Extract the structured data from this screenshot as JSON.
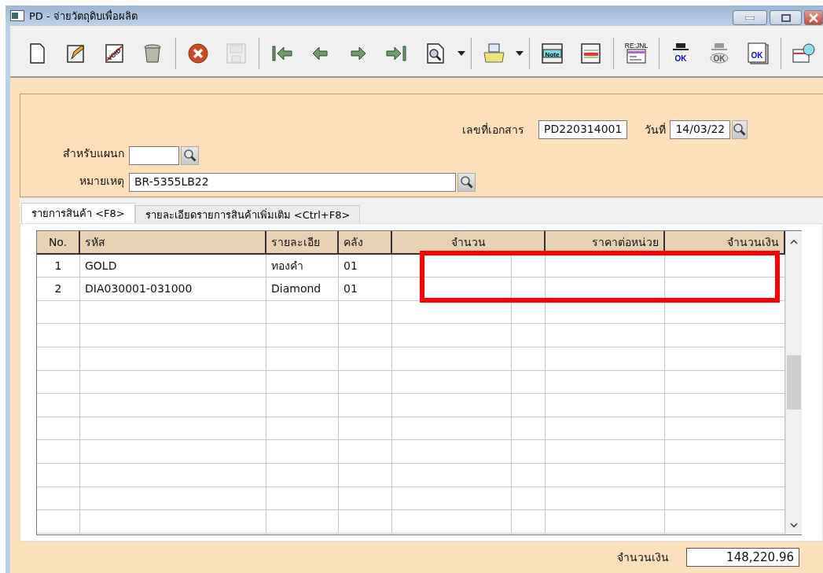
{
  "window": {
    "title": "PD - จ่ายวัตถุดิบเพื่อผลิต"
  },
  "toolbar": [
    {
      "kind": "new",
      "disabled": false
    },
    {
      "kind": "edit",
      "disabled": false
    },
    {
      "kind": "void",
      "label": "VOID",
      "disabled": false
    },
    {
      "kind": "trash",
      "disabled": false
    },
    {
      "kind": "separator"
    },
    {
      "kind": "cancel",
      "disabled": false
    },
    {
      "kind": "save",
      "disabled": true
    },
    {
      "kind": "separator"
    },
    {
      "kind": "first",
      "disabled": false
    },
    {
      "kind": "prev",
      "disabled": false
    },
    {
      "kind": "next",
      "disabled": false
    },
    {
      "kind": "last",
      "disabled": false
    },
    {
      "kind": "find",
      "disabled": false,
      "dropdown": true
    },
    {
      "kind": "separator"
    },
    {
      "kind": "print",
      "disabled": false,
      "dropdown": true
    },
    {
      "kind": "separator"
    },
    {
      "kind": "note",
      "label": "Note",
      "disabled": false
    },
    {
      "kind": "sheet",
      "disabled": false
    },
    {
      "kind": "separator"
    },
    {
      "kind": "journal",
      "label": "RE:JNL",
      "disabled": false
    },
    {
      "kind": "separator"
    },
    {
      "kind": "approve",
      "label": "OK",
      "disabled": false
    },
    {
      "kind": "approve",
      "label": "OK",
      "disabled": true
    },
    {
      "kind": "approve-doc",
      "label": "OK",
      "disabled": false
    },
    {
      "kind": "separator"
    },
    {
      "kind": "table-search",
      "disabled": false
    }
  ],
  "form": {
    "department": {
      "label": "สำหรับแผนก"
    },
    "remark": {
      "label": "หมายเหตุ",
      "value": "BR-5355LB22"
    },
    "doc_no": {
      "label": "เลขที่เอกสาร",
      "value": "PD220314001"
    },
    "date": {
      "label": "วันที่",
      "value": "14/03/22"
    }
  },
  "tabs": [
    {
      "label": "รายการสินค้า <F8>",
      "selected": true
    },
    {
      "label": "รายละเอียดรายการสินค้าเพิ่มเติม  <Ctrl+F8>",
      "selected": false
    }
  ],
  "table": {
    "columns": [
      {
        "label": "No.",
        "kind": "index"
      },
      {
        "label": "รหัส",
        "kind": "text"
      },
      {
        "label": "รายละเอีย",
        "kind": "text"
      },
      {
        "label": "คลัง",
        "kind": "text"
      },
      {
        "label": "จำนวน",
        "kind": "quantity"
      },
      {
        "label": "ราคาต่อหน่วย",
        "kind": "number"
      },
      {
        "label": "จำนวนเงิน",
        "kind": "number"
      }
    ],
    "rows": [
      {
        "no": "1",
        "code": "GOLD",
        "description": "ทองคำ",
        "warehouse": "01"
      },
      {
        "no": "2",
        "code": "DIA030001-031000",
        "description": "Diamond",
        "warehouse": "01"
      }
    ]
  },
  "total": {
    "label": "จำนวนเงิน",
    "value": "148,220.96"
  }
}
